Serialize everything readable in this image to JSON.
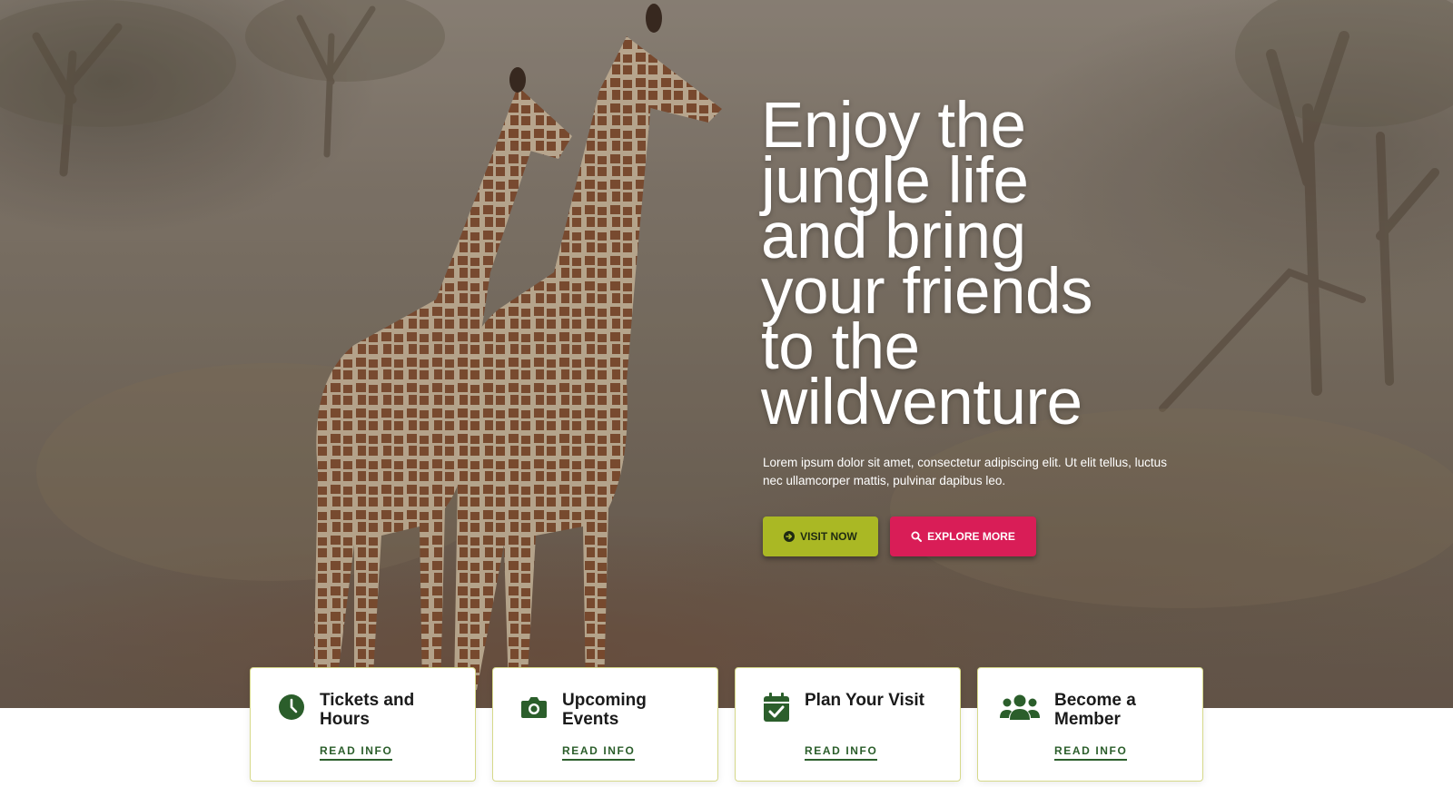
{
  "hero": {
    "title_lines": [
      "Enjoy the",
      "jungle life",
      "and bring",
      "your friends",
      "to the",
      "wildventure"
    ],
    "description": "Lorem ipsum dolor sit amet, consectetur adipiscing elit. Ut elit tellus, luctus nec ullamcorper mattis, pulvinar dapibus leo.",
    "buttons": {
      "visit": {
        "label": "VISIT NOW",
        "icon": "arrow-circle-right-icon",
        "color": "#aab824"
      },
      "explore": {
        "label": "EXPLORE MORE",
        "icon": "search-icon",
        "color": "#d91d57"
      }
    }
  },
  "cards": [
    {
      "title": "Tickets and Hours",
      "link": "READ INFO",
      "icon": "clock-icon"
    },
    {
      "title": "Upcoming Events",
      "link": "READ INFO",
      "icon": "camera-icon"
    },
    {
      "title": "Plan Your Visit",
      "link": "READ INFO",
      "icon": "calendar-check-icon"
    },
    {
      "title": "Become a Member",
      "link": "READ INFO",
      "icon": "users-icon"
    }
  ],
  "colors": {
    "accent_green": "#2b5e2b",
    "lime": "#aab824",
    "pink": "#d91d57"
  }
}
